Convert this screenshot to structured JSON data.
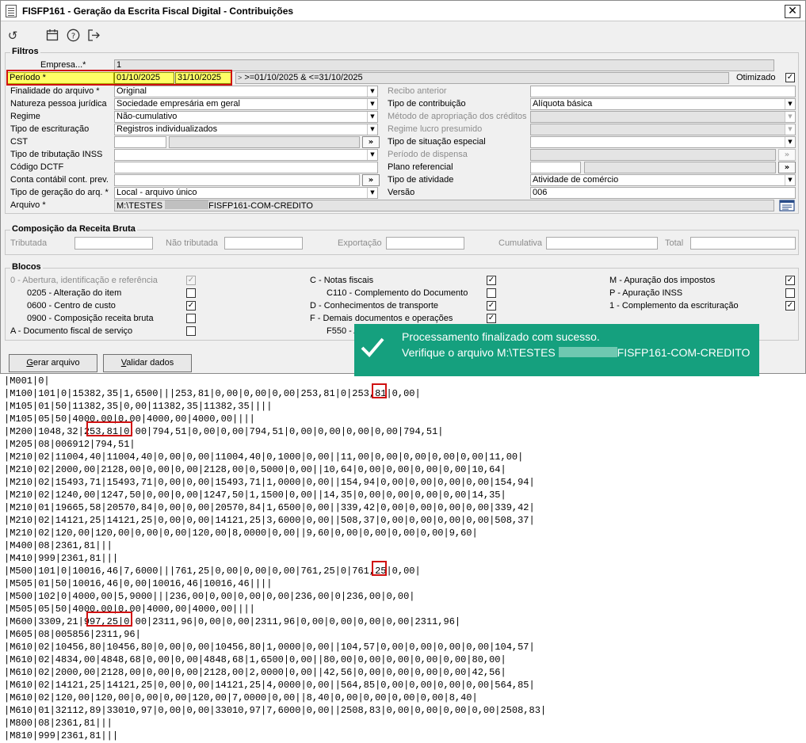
{
  "window": {
    "title": "FISFP161 - Geração da Escrita Fiscal Digital - Contribuições",
    "close_label": "✕"
  },
  "toolbar": {
    "icons": [
      "refresh-icon",
      "calendar-icon",
      "help-icon",
      "exit-icon"
    ]
  },
  "filtros": {
    "legend": "Filtros",
    "empresa_label": "Empresa...*",
    "empresa_value": "1",
    "periodo_label": "Período *",
    "periodo_inicio": "01/10/2025",
    "periodo_fim": "31/10/2025",
    "periodo_expr": ">=01/10/2025 & <=31/10/2025",
    "otimizado_label": "Otimizado",
    "otimizado_checked": true,
    "left": [
      {
        "label": "Finalidade do arquivo *",
        "value": "Original"
      },
      {
        "label": "Natureza pessoa jurídica",
        "value": "Sociedade empresária em geral"
      },
      {
        "label": "Regime",
        "value": "Não-cumulativo"
      },
      {
        "label": "Tipo de escrituração",
        "value": "Registros individualizados"
      },
      {
        "label": "CST",
        "value": ""
      },
      {
        "label": "Tipo de tributação INSS",
        "value": ""
      },
      {
        "label": "Código DCTF",
        "value": ""
      },
      {
        "label": "Conta contábil cont. prev.",
        "value": ""
      },
      {
        "label": "Tipo de geração do arq. *",
        "value": "Local - arquivo único"
      }
    ],
    "right": [
      {
        "label": "Recibo anterior",
        "value": ""
      },
      {
        "label": "Tipo de contribuição",
        "value": "Alíquota básica"
      },
      {
        "label": "Método de apropriação dos créditos",
        "value": ""
      },
      {
        "label": "Regime lucro presumido",
        "value": ""
      },
      {
        "label": "Tipo de situação especial",
        "value": ""
      },
      {
        "label": "Período de dispensa",
        "value": ""
      },
      {
        "label": "Plano referencial",
        "value": ""
      },
      {
        "label": "Tipo de atividade",
        "value": "Atividade de comércio"
      },
      {
        "label": "Versão",
        "value": "006"
      }
    ],
    "arquivo_label": "Arquivo *",
    "arquivo_prefix": "M:\\TESTES",
    "arquivo_suffix": "FISFP161-COM-CREDITO"
  },
  "composicao": {
    "legend": "Composição da Receita Bruta",
    "labels": [
      "Tributada",
      "Não tributada",
      "Exportação",
      "Cumulativa",
      "Total"
    ]
  },
  "blocos": {
    "legend": "Blocos",
    "col1": [
      {
        "label": "0 - Abertura, identificação e referência",
        "checked": true,
        "disabled": true
      },
      {
        "label": "0205 - Alteração do item",
        "checked": false
      },
      {
        "label": "0600 - Centro de custo",
        "checked": true
      },
      {
        "label": "0900 - Composição receita bruta",
        "checked": false
      },
      {
        "label": "A - Documento fiscal de serviço",
        "checked": false
      }
    ],
    "col2": [
      {
        "label": "C - Notas fiscais",
        "checked": true
      },
      {
        "label": "C110 - Complemento do Documento",
        "checked": false
      },
      {
        "label": "D - Conhecimentos de transporte",
        "checked": true
      },
      {
        "label": "F - Demais documentos e operações",
        "checked": true
      },
      {
        "label": "F550 - A",
        "checked": false
      }
    ],
    "col3": [
      {
        "label": "M - Apuração dos impostos",
        "checked": true
      },
      {
        "label": "P - Apuração INSS",
        "checked": false
      },
      {
        "label": "1 - Complemento da escrituração",
        "checked": true
      }
    ]
  },
  "buttons": {
    "gerar_first": "G",
    "gerar_rest": "erar arquivo",
    "validar_first": "V",
    "validar_rest": "alidar dados"
  },
  "toast": {
    "line1": "Processamento finalizado com sucesso.",
    "line2_prefix": "Verifique o arquivo M:\\TESTES",
    "line2_suffix": "FISFP161-COM-CREDITO"
  },
  "file_lines": [
    "|M001|0|",
    "|M100|101|0|15382,35|1,6500|||253,81|0,00|0,00|0,00|253,81|0|253,81|0,00|",
    "|M105|01|50|11382,35|0,00|11382,35|11382,35||||",
    "|M105|05|50|4000,00|0,00|4000,00|4000,00||||",
    "|M200|1048,32|253,81|0,00|794,51|0,00|0,00|794,51|0,00|0,00|0,00|0,00|794,51|",
    "|M205|08|006912|794,51|",
    "|M210|02|11004,40|11004,40|0,00|0,00|11004,40|0,1000|0,00||11,00|0,00|0,00|0,00|0,00|11,00|",
    "|M210|02|2000,00|2128,00|0,00|0,00|2128,00|0,5000|0,00||10,64|0,00|0,00|0,00|0,00|10,64|",
    "|M210|02|15493,71|15493,71|0,00|0,00|15493,71|1,0000|0,00||154,94|0,00|0,00|0,00|0,00|154,94|",
    "|M210|02|1240,00|1247,50|0,00|0,00|1247,50|1,1500|0,00||14,35|0,00|0,00|0,00|0,00|14,35|",
    "|M210|01|19665,58|20570,84|0,00|0,00|20570,84|1,6500|0,00||339,42|0,00|0,00|0,00|0,00|339,42|",
    "|M210|02|14121,25|14121,25|0,00|0,00|14121,25|3,6000|0,00||508,37|0,00|0,00|0,00|0,00|508,37|",
    "|M210|02|120,00|120,00|0,00|0,00|120,00|8,0000|0,00||9,60|0,00|0,00|0,00|0,00|9,60|",
    "|M400|08|2361,81|||",
    "|M410|999|2361,81|||",
    "|M500|101|0|10016,46|7,6000|||761,25|0,00|0,00|0,00|761,25|0|761,25|0,00|",
    "|M505|01|50|10016,46|0,00|10016,46|10016,46||||",
    "|M500|102|0|4000,00|5,9000|||236,00|0,00|0,00|0,00|236,00|0|236,00|0,00|",
    "|M505|05|50|4000,00|0,00|4000,00|4000,00||||",
    "|M600|3309,21|997,25|0,00|2311,96|0,00|0,00|2311,96|0,00|0,00|0,00|0,00|2311,96|",
    "|M605|08|005856|2311,96|",
    "|M610|02|10456,80|10456,80|0,00|0,00|10456,80|1,0000|0,00||104,57|0,00|0,00|0,00|0,00|104,57|",
    "|M610|02|4834,00|4848,68|0,00|0,00|4848,68|1,6500|0,00||80,00|0,00|0,00|0,00|0,00|80,00|",
    "|M610|02|2000,00|2128,00|0,00|0,00|2128,00|2,0000|0,00||42,56|0,00|0,00|0,00|0,00|42,56|",
    "|M610|02|14121,25|14121,25|0,00|0,00|14121,25|4,0000|0,00||564,85|0,00|0,00|0,00|0,00|564,85|",
    "|M610|02|120,00|120,00|0,00|0,00|120,00|7,0000|0,00||8,40|0,00|0,00|0,00|0,00|8,40|",
    "|M610|01|32112,89|33010,97|0,00|0,00|33010,97|7,6000|0,00||2508,83|0,00|0,00|0,00|0,00|2508,83|",
    "|M800|08|2361,81|||",
    "|M810|999|2361,81|||"
  ],
  "highlight_color": "#d01010",
  "toast_color": "#15a07e"
}
